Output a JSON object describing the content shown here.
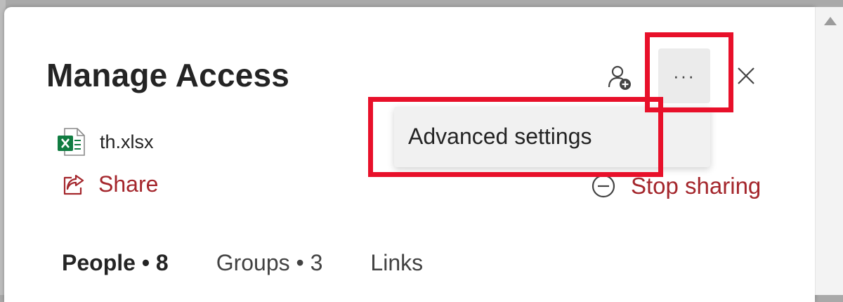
{
  "dialog": {
    "title": "Manage Access",
    "more_label": "···",
    "file_name": "th.xlsx",
    "share_label": "Share",
    "stop_sharing_label": "Stop sharing"
  },
  "menu": {
    "items": [
      {
        "label": "Advanced settings"
      }
    ]
  },
  "tabs": [
    {
      "label": "People • 8",
      "active": true
    },
    {
      "label": "Groups • 3",
      "active": false
    },
    {
      "label": "Links",
      "active": false
    }
  ],
  "icons": {
    "add_people": "add-person-icon",
    "more": "more-options-icon",
    "close": "close-icon",
    "file": "excel-file-icon",
    "share": "share-icon",
    "stop_sharing": "stop-sharing-icon",
    "scroll_up": "scroll-up-arrow-icon"
  },
  "colors": {
    "accent": "#a4262c",
    "excel_green": "#107c41",
    "annotation": "#e8102a"
  }
}
